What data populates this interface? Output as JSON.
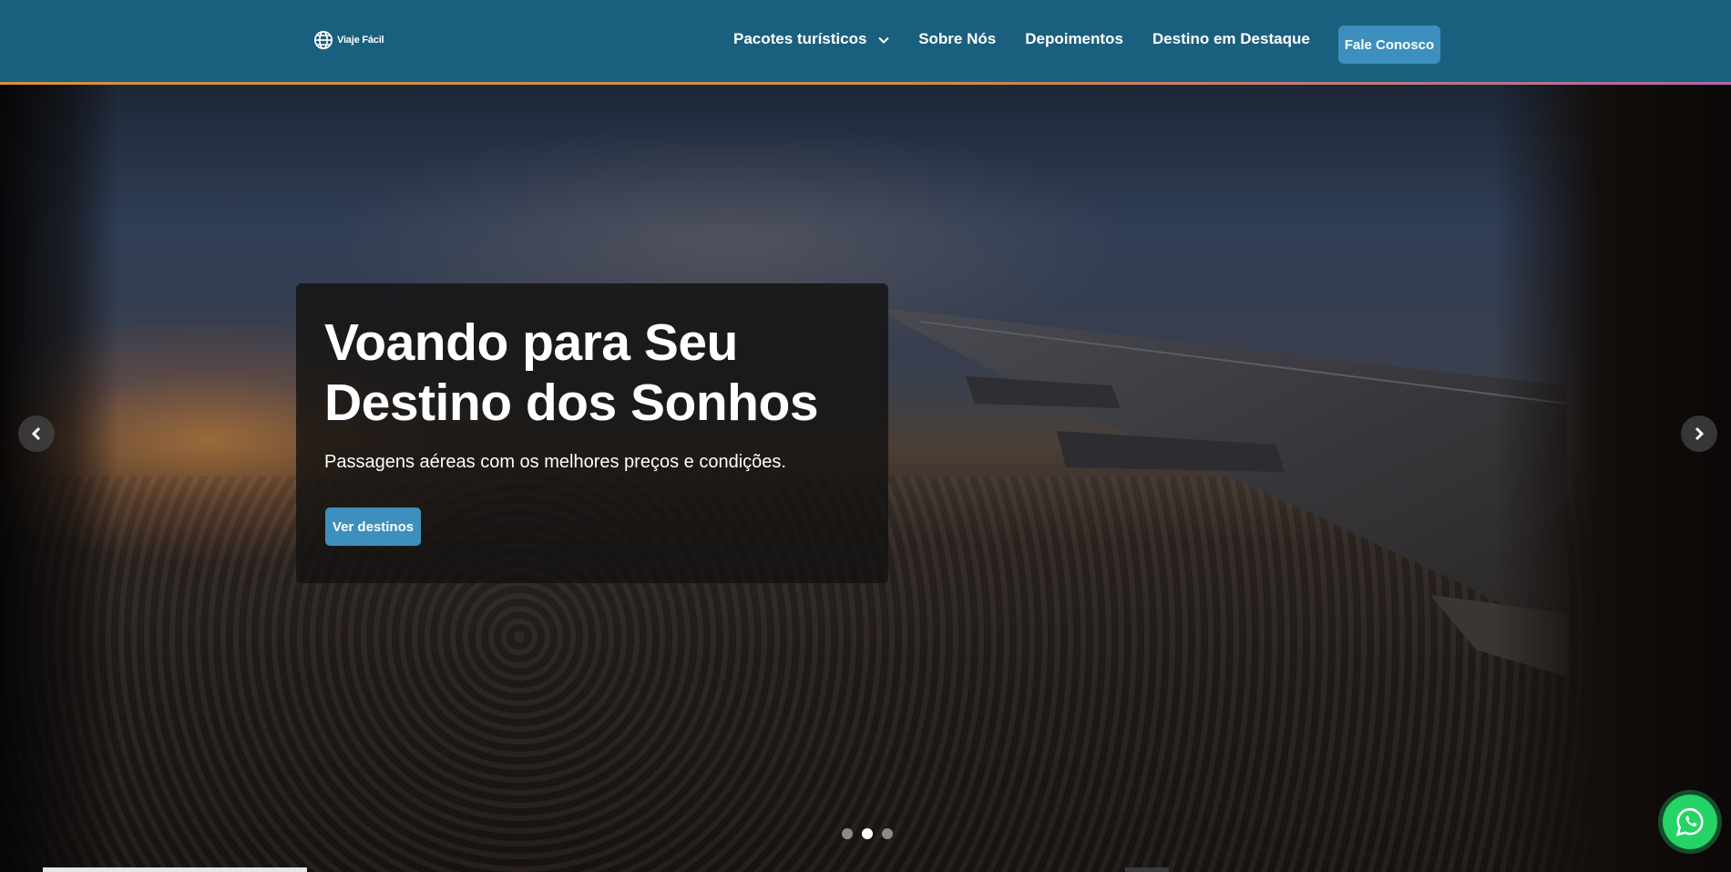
{
  "header": {
    "logo_text": "Viaje Fácil",
    "logo_icon": "globe-icon",
    "nav": [
      {
        "label": "Pacotes turísticos",
        "has_dropdown": true
      },
      {
        "label": "Sobre Nós"
      },
      {
        "label": "Depoimentos"
      },
      {
        "label": "Destino em Destaque"
      }
    ],
    "cta_label": "Fale Conosco",
    "colors": {
      "bar": "#1b5f7e",
      "accent": "#3d8fbd"
    }
  },
  "hero": {
    "title": "Voando para Seu Destino dos Sonhos",
    "subtitle": "Passagens aéreas com os melhores preços e condições.",
    "button_label": "Ver destinos",
    "slides": 3,
    "active_slide": 2
  },
  "icons": {
    "prev": "chevron-left-icon",
    "next": "chevron-right-icon",
    "whatsapp": "whatsapp-icon"
  }
}
